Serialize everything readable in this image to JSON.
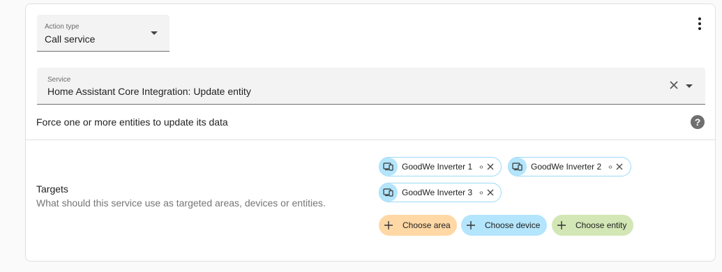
{
  "action_type": {
    "label": "Action type",
    "value": "Call service"
  },
  "service": {
    "label": "Service",
    "value": "Home Assistant Core Integration: Update entity"
  },
  "description": "Force one or more entities to update its data",
  "targets": {
    "label": "Targets",
    "sublabel": "What should this service use as targeted areas, devices or entities.",
    "chips": [
      {
        "name": "GoodWe Inverter 1",
        "icon": "device-icon"
      },
      {
        "name": "GoodWe Inverter 2",
        "icon": "device-icon"
      },
      {
        "name": "GoodWe Inverter 3",
        "icon": "device-icon"
      }
    ],
    "add_buttons": {
      "area": "Choose area",
      "device": "Choose device",
      "entity": "Choose entity"
    }
  },
  "icons": {
    "menu": "more-vertical-icon",
    "help": "help-circle-icon",
    "clear": "close-icon",
    "dropdown": "menu-down-icon",
    "expand": "unfold-icon",
    "plus": "plus-icon"
  },
  "colors": {
    "area": "#ffd8a6",
    "device": "#b3e5fc",
    "entity": "#d3e7b6"
  }
}
